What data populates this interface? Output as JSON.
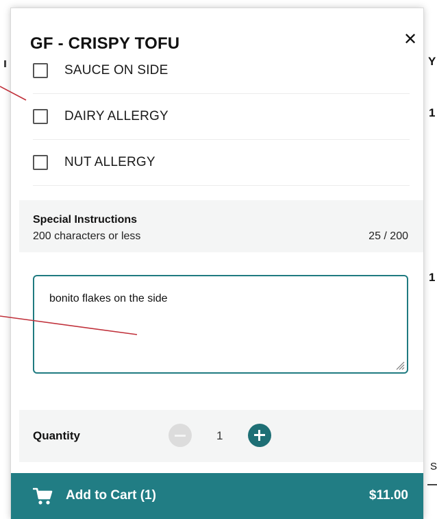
{
  "modal": {
    "title": "GF - CRISPY TOFU",
    "close_glyph": "✕"
  },
  "options": [
    {
      "label": "SAUCE ON SIDE",
      "checked": false
    },
    {
      "label": "DAIRY ALLERGY",
      "checked": false
    },
    {
      "label": "NUT ALLERGY",
      "checked": false
    }
  ],
  "instructions": {
    "heading": "Special Instructions",
    "subtext": "200 characters or less",
    "counter": "25 / 200",
    "value": "bonito flakes on the side"
  },
  "quantity": {
    "label": "Quantity",
    "value": "1"
  },
  "cart": {
    "label": "Add to Cart (1)",
    "total": "$11.00"
  },
  "icons": {
    "close": "close-icon",
    "cart": "shopping-cart-icon",
    "minus": "minus-circle-icon",
    "plus": "plus-circle-icon"
  },
  "colors": {
    "accent": "#217d84",
    "annotation": "#c0303a"
  },
  "background_page": {
    "glyphs": [
      "Y",
      "1",
      "1",
      "S"
    ]
  }
}
